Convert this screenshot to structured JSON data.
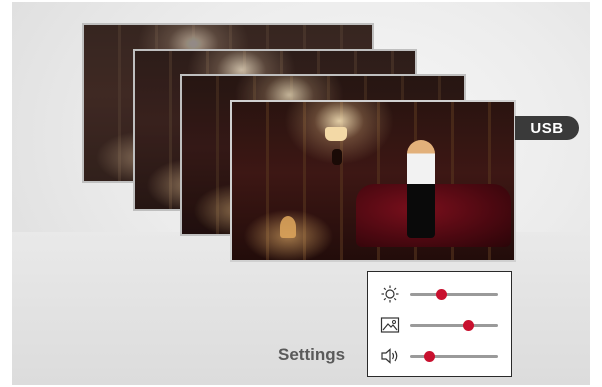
{
  "source_tag": {
    "label": "USB"
  },
  "settings": {
    "label": "Settings",
    "sliders": [
      {
        "name": "brightness",
        "icon": "sun-icon",
        "level": 0.35
      },
      {
        "name": "picture",
        "icon": "image-icon",
        "level": 0.66
      },
      {
        "name": "volume",
        "icon": "speaker-icon",
        "level": 0.22
      }
    ]
  },
  "colors": {
    "accent": "#c8102e",
    "track": "#9a9a9a",
    "tag_background": "#3a3a3a",
    "panel_border": "#2a2a2a"
  }
}
